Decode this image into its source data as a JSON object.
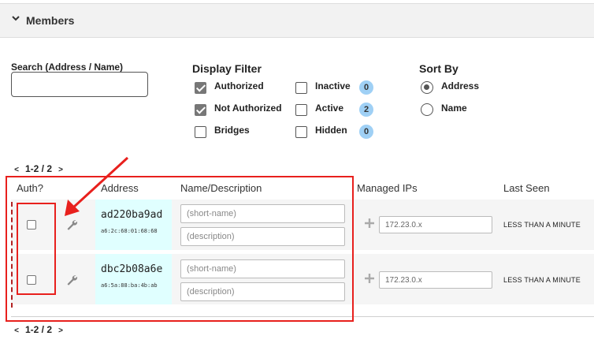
{
  "header": {
    "title": "Members"
  },
  "search": {
    "label": "Search (Address / Name)",
    "value": ""
  },
  "display_filter": {
    "title": "Display Filter",
    "options": [
      {
        "label": "Authorized",
        "checked": true
      },
      {
        "label": "Not Authorized",
        "checked": true
      },
      {
        "label": "Bridges",
        "checked": false
      },
      {
        "label": "Inactive",
        "checked": false,
        "count": "0"
      },
      {
        "label": "Active",
        "checked": false,
        "count": "2"
      },
      {
        "label": "Hidden",
        "checked": false,
        "count": "0"
      }
    ]
  },
  "sort_by": {
    "title": "Sort By",
    "options": [
      {
        "label": "Address",
        "selected": true
      },
      {
        "label": "Name",
        "selected": false
      }
    ]
  },
  "pagination": {
    "prev": "<",
    "next": ">",
    "text": "1-2 / 2"
  },
  "columns": {
    "auth": "Auth?",
    "address": "Address",
    "name": "Name/Description",
    "ips": "Managed IPs",
    "last_seen": "Last Seen"
  },
  "members": [
    {
      "id": "ad220ba9ad",
      "mac": "a6:2c:68:01:68:68",
      "authorized": false,
      "name_placeholder": "(short-name)",
      "desc_placeholder": "(description)",
      "ip_placeholder": "172.23.0.x",
      "last_seen": "LESS THAN A MINUTE"
    },
    {
      "id": "dbc2b08a6e",
      "mac": "a6:5a:88:ba:4b:ab",
      "authorized": false,
      "name_placeholder": "(short-name)",
      "desc_placeholder": "(description)",
      "ip_placeholder": "172.23.0.x",
      "last_seen": "LESS THAN A MINUTE"
    }
  ],
  "colors": {
    "annotation": "#e8201d",
    "address_cell": "#e0ffff",
    "badge": "#9fd0f5",
    "checked_box": "#777777"
  }
}
